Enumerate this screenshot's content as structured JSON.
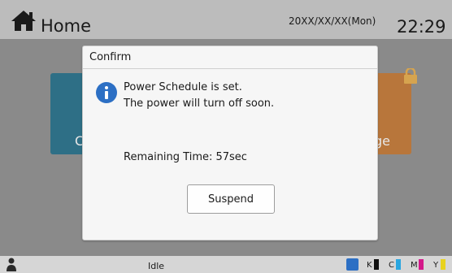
{
  "header": {
    "title": "Home",
    "date": "20XX/XX/XX(Mon)",
    "time": "22:29"
  },
  "content": {
    "tile_left_label": "C",
    "tile_right_label": "ge"
  },
  "dialog": {
    "title": "Confirm",
    "message_line1": "Power Schedule is set.",
    "message_line2": "The power will turn off soon.",
    "remaining": "Remaining Time: 57sec",
    "suspend_label": "Suspend"
  },
  "statusbar": {
    "status": "Idle",
    "toner": [
      {
        "label": "K",
        "color": "#111111"
      },
      {
        "label": "C",
        "color": "#2aa6e0"
      },
      {
        "label": "M",
        "color": "#d4198a"
      },
      {
        "label": "Y",
        "color": "#e8d21e"
      }
    ]
  },
  "colors": {
    "header_bg": "#bcbcbc",
    "dialog_bg": "#f6f6f6",
    "info_blue": "#2c6fc4"
  }
}
